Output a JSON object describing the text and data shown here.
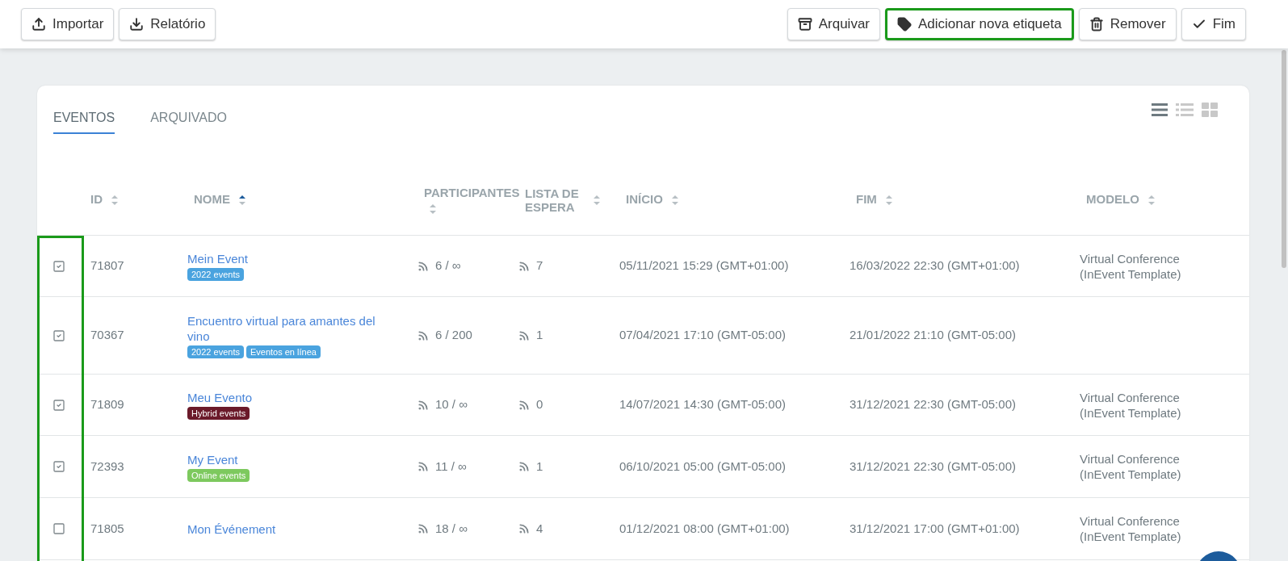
{
  "toolbar": {
    "left": [
      {
        "kind": "import",
        "label": "Importar",
        "highlighted": false
      },
      {
        "kind": "report",
        "label": "Relatório",
        "highlighted": false
      }
    ],
    "right": [
      {
        "kind": "archive",
        "label": "Arquivar",
        "highlighted": false
      },
      {
        "kind": "tag",
        "label": "Adicionar nova etiqueta",
        "highlighted": true
      },
      {
        "kind": "remove",
        "label": "Remover",
        "highlighted": false
      },
      {
        "kind": "finish",
        "label": "Fim",
        "highlighted": false
      }
    ]
  },
  "tabs": [
    {
      "label": "EVENTOS",
      "selected": true
    },
    {
      "label": "ARQUIVADO",
      "selected": false
    }
  ],
  "view_modes": [
    {
      "kind": "list",
      "selected": true
    },
    {
      "kind": "detailed",
      "selected": false
    },
    {
      "kind": "grid",
      "selected": false
    }
  ],
  "table": {
    "checkbox_column_highlighted": true,
    "columns": [
      {
        "label": "ID",
        "sorted_ascending": false
      },
      {
        "label": "NOME",
        "sorted_ascending": true
      },
      {
        "label": "PARTICIPANTES",
        "sorted_ascending": false
      },
      {
        "label": "LISTA DE ESPERA",
        "sorted_ascending": false
      },
      {
        "label": "INÍCIO",
        "sorted_ascending": false
      },
      {
        "label": "FIM",
        "sorted_ascending": false
      },
      {
        "label": "MODELO",
        "sorted_ascending": false
      }
    ],
    "rows": [
      {
        "checked": true,
        "id": "71807",
        "name": "Mein Event",
        "tags": [
          {
            "label": "2022 events",
            "color": "#4aa3df"
          }
        ],
        "participants": "6 / ∞",
        "waitlist": "7",
        "start": "05/11/2021 15:29 (GMT+01:00)",
        "end": "16/03/2022 22:30 (GMT+01:00)",
        "model": "Virtual Conference (InEvent Template)"
      },
      {
        "checked": true,
        "id": "70367",
        "name": "Encuentro virtual para amantes del vino",
        "tags": [
          {
            "label": "2022 events",
            "color": "#4aa3df"
          },
          {
            "label": "Eventos en línea",
            "color": "#4aa3df"
          }
        ],
        "participants": "6 / 200",
        "waitlist": "1",
        "start": "07/04/2021 17:10 (GMT-05:00)",
        "end": "21/01/2022 21:10 (GMT-05:00)"
      },
      {
        "checked": true,
        "id": "71809",
        "name": "Meu Evento",
        "tags": [
          {
            "label": "Hybrid events",
            "color": "#6b1a2a"
          }
        ],
        "participants": "10 / ∞",
        "waitlist": "0",
        "start": "14/07/2021 14:30 (GMT-05:00)",
        "end": "31/12/2021 22:30 (GMT-05:00)",
        "model": "Virtual Conference (InEvent Template)"
      },
      {
        "checked": true,
        "id": "72393",
        "name": "My Event",
        "tags": [
          {
            "label": "Online events",
            "color": "#7dc95e"
          }
        ],
        "participants": "11 / ∞",
        "waitlist": "1",
        "start": "06/10/2021 05:00 (GMT-05:00)",
        "end": "31/12/2021 22:30 (GMT-05:00)",
        "model": "Virtual Conference (InEvent Template)"
      },
      {
        "checked": false,
        "id": "71805",
        "name": "Mon Événement",
        "tags": [],
        "participants": "18 / ∞",
        "waitlist": "4",
        "start": "01/12/2021 08:00 (GMT+01:00)",
        "end": "31/12/2021 17:00 (GMT+01:00)",
        "model": "Virtual Conference (InEvent Template)"
      }
    ]
  }
}
